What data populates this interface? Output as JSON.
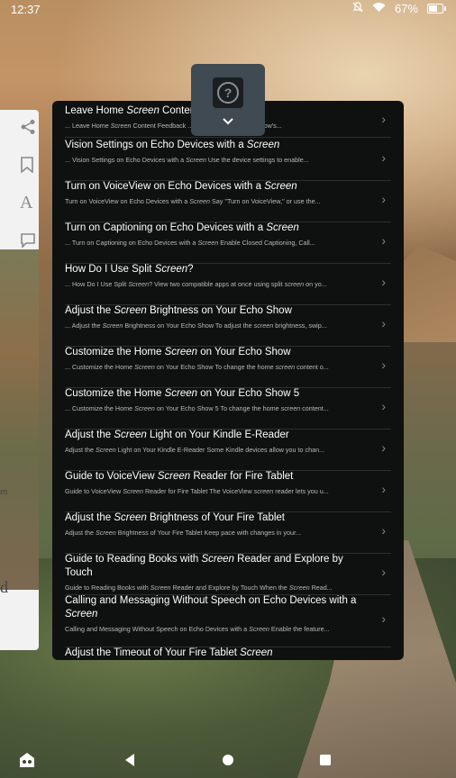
{
  "status_bar": {
    "time": "12:37",
    "battery": "67%",
    "battery_level": 0.67
  },
  "help": {
    "glyph": "?",
    "chevron": "⌄"
  },
  "reader": {
    "fragments": [
      "m",
      "d"
    ]
  },
  "results": [
    {
      "title": "Leave Home Screen Content",
      "snippet": "... Leave Home Screen Content Feedback ... played on your Echo Show's..."
    },
    {
      "title": "Vision Settings on Echo Devices with a Screen",
      "snippet": "... Vision Settings on Echo Devices with a Screen Use the device settings to enable..."
    },
    {
      "title": "Turn on VoiceView on Echo Devices with a Screen",
      "snippet": "Turn on VoiceView on Echo Devices with a Screen Say \"Turn on VoiceView,\" or use the..."
    },
    {
      "title": "Turn on Captioning on Echo Devices with a Screen",
      "snippet": "... Turn on Captioning on Echo Devices with a Screen Enable Closed Captioning, Call..."
    },
    {
      "title": "How Do I Use Split Screen?",
      "snippet": "... How Do I Use Split Screen? View two compatible apps at once using split screen on yo..."
    },
    {
      "title": "Adjust the Screen Brightness on Your Echo Show",
      "snippet": "... Adjust the Screen Brightness on Your Echo Show To adjust the screen brightness, swip..."
    },
    {
      "title": "Customize the Home Screen on Your Echo Show",
      "snippet": "... Customize the Home Screen on Your Echo Show To change the home screen content o..."
    },
    {
      "title": "Customize the Home Screen on Your Echo Show 5",
      "snippet": "... Customize the Home Screen on Your Echo Show 5 To change the home screen content..."
    },
    {
      "title": "Adjust the Screen Light on Your Kindle E-Reader",
      "snippet": "Adjust the Screen Light on Your Kindle E-Reader Some Kindle devices allow you to chan..."
    },
    {
      "title": "Guide to VoiceView Screen Reader for Fire Tablet",
      "snippet": "Guide to VoiceView Screen Reader for Fire Tablet The VoiceView screen reader lets you u..."
    },
    {
      "title": "Adjust the Screen Brightness of Your Fire Tablet",
      "snippet": "Adjust the Screen Brightness of Your Fire Tablet Keep pace with changes in your..."
    },
    {
      "title": "Guide to Reading Books with Screen Reader and Explore by Touch",
      "snippet": "Guide to Reading Books with Screen Reader and Explore by Touch When the Screen Read..."
    },
    {
      "title": "Calling and Messaging Without Speech on Echo Devices with a Screen",
      "snippet": "Calling and Messaging Without Speech on Echo Devices with a Screen Enable the feature..."
    },
    {
      "title": "Adjust the Timeout of Your Fire Tablet Screen",
      "snippet": ""
    }
  ],
  "icons": {
    "share": "share-icon",
    "bookmark": "bookmark-icon",
    "font": "font-icon",
    "notes": "notes-icon",
    "back": "back-icon",
    "home": "home-icon",
    "recents": "recents-icon",
    "nav_home_app": "kids-home-icon"
  }
}
